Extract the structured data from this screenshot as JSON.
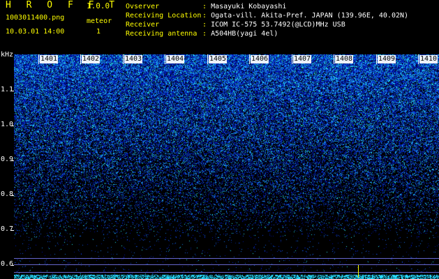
{
  "header": {
    "app_title": "H R O F F T",
    "app_version": "1.0.0",
    "filename": "1003011400.png",
    "date_time": "10.03.01 14:00",
    "meteor_label": "meteor",
    "meteor_count": "1",
    "fields": [
      {
        "label": "Ovserver",
        "sep": ":",
        "value": "Masayuki Kobayashi"
      },
      {
        "label": "Receiving Location",
        "sep": ":",
        "value": "Ogata-vill. Akita-Pref. JAPAN (139.96E, 40.02N)"
      },
      {
        "label": "Receiver",
        "sep": ":",
        "value": "ICOM IC-575 53.7492(@LCD)MHz USB"
      },
      {
        "label": "Receiving antenna",
        "sep": ":",
        "value": "A504HB(yagi 4el)"
      }
    ]
  },
  "y_axis": {
    "unit": "kHz",
    "ticks": [
      "1.1",
      "1.0",
      "0.9",
      "0.8",
      "0.7",
      "0.6"
    ]
  },
  "x_axis": {
    "ticks": [
      "1401",
      "1402",
      "1403",
      "1404",
      "1405",
      "1406",
      "1407",
      "1408",
      "1409",
      "1410"
    ]
  },
  "colors": {
    "background": "#000000",
    "header_text": "#ffff00",
    "info_text": "#ffffff",
    "noise_low": "#000066",
    "noise_mid": "#0033ff",
    "noise_high": "#00ffff",
    "meteor": "#ffff00",
    "reference_line": "#8888ff"
  }
}
